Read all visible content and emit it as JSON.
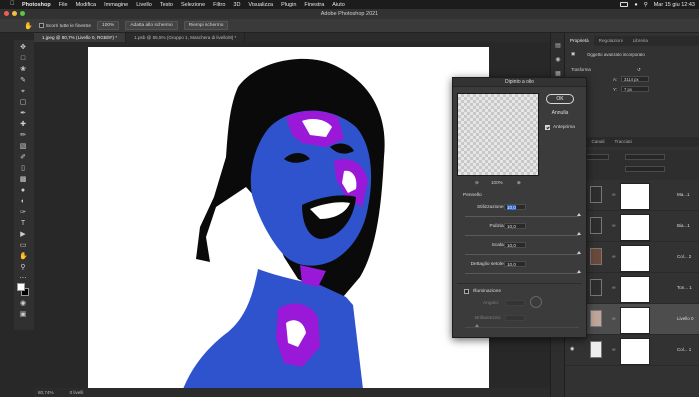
{
  "menubar": {
    "app": "Photoshop",
    "items": [
      "File",
      "Modifica",
      "Immagine",
      "Livello",
      "Testo",
      "Selezione",
      "Filtro",
      "3D",
      "Visualizza",
      "Plugin",
      "Finestra",
      "Aiuto"
    ],
    "datetime": "Mar 15 giu  12:43"
  },
  "window": {
    "title": "Adobe Photoshop 2021"
  },
  "options": {
    "checkbox_label": "Scorri tutte le finestre",
    "zoom_button": "100%",
    "fit_button": "Adatta allo schermo",
    "fill_button": "Riempi schermo"
  },
  "tabs": [
    "1.jpeg @ 80,7% (Livello 0, RGB/8*) *",
    "1.psb @ 55,5% (Gruppo 1, Maschera di livello/8) *"
  ],
  "statusbar": {
    "zoom": "80,74%",
    "info": "0 livelli"
  },
  "properties_panel": {
    "tabs": [
      "Proprietà",
      "Regolazioni",
      "Libreria"
    ],
    "object_label": "Oggetto avanzato incorporato",
    "section": "Trasforma",
    "h_label": "A:",
    "h_value": "3114 px",
    "y_label": "Y:",
    "y_value": "7 px"
  },
  "layers_panel": {
    "tabs": [
      "Livelli",
      "Canali",
      "Tracciati"
    ],
    "layers": [
      {
        "name": "Ma...1",
        "thumb": "#2e2e2e",
        "visible": false
      },
      {
        "name": "Bia...1",
        "thumb": "#2e2e2e",
        "visible": false
      },
      {
        "name": "Col... 2",
        "thumb": "#6b4a3c",
        "visible": false
      },
      {
        "name": "Ton... 1",
        "thumb": "#2e2e2e",
        "visible": false
      },
      {
        "name": "Livello 0",
        "thumb": "#bfa59a",
        "visible": false,
        "selected": true
      },
      {
        "name": "Col... 1",
        "thumb": "#eeeeee",
        "visible": true
      }
    ]
  },
  "dialog": {
    "title": "Dipinto a olio",
    "ok": "OK",
    "cancel": "Annulla",
    "preview_label": "Anteprima",
    "zoom": "100%",
    "brush_section": "Pennello",
    "fields": [
      {
        "label": "Stilizzazione:",
        "value": "10,0",
        "knob": 1.0
      },
      {
        "label": "Pulizia:",
        "value": "10,0",
        "knob": 1.0
      },
      {
        "label": "Scala:",
        "value": "10,0",
        "knob": 1.0
      },
      {
        "label": "Dettaglio setole:",
        "value": "10,0",
        "knob": 1.0
      }
    ],
    "lighting_label": "Illuminazione",
    "angle_label": "Angolo:",
    "brightness_label": "Brillantezza:"
  },
  "colors": {
    "blue": "#2f53cc",
    "purple": "#9a18d8",
    "skin": "#ffffff",
    "hair": "#0a0a0a"
  }
}
